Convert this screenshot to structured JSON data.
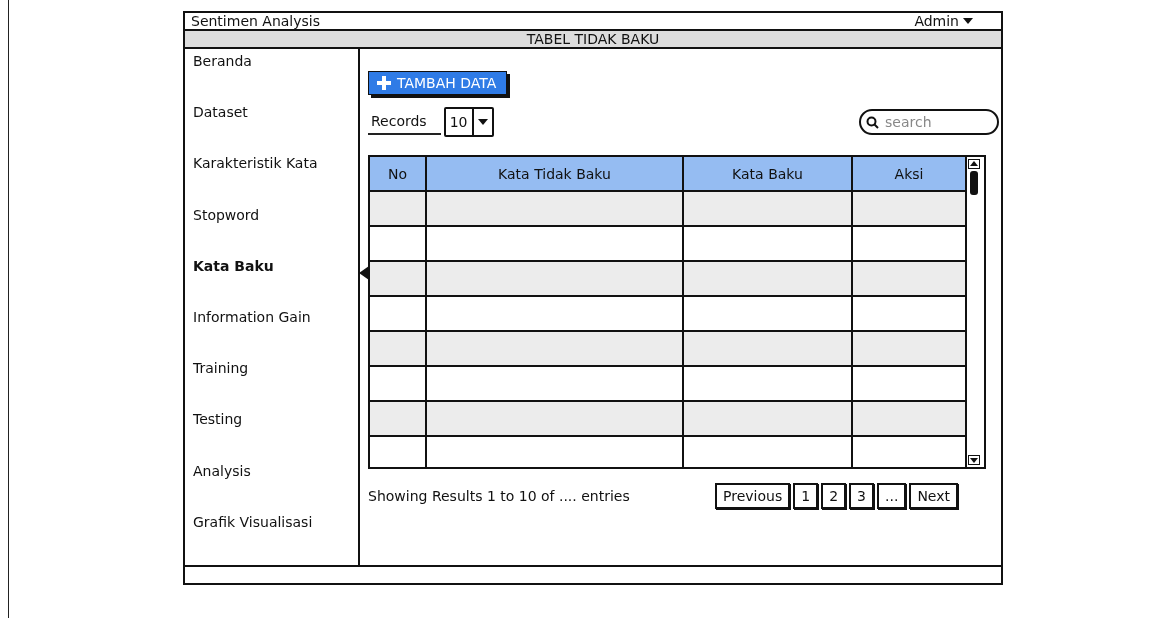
{
  "app_title": "Sentimen Analysis",
  "user_menu": {
    "label": "Admin"
  },
  "page_title": "TABEL TIDAK BAKU",
  "sidebar": {
    "items": [
      {
        "label": "Beranda",
        "selected": false
      },
      {
        "label": "Dataset",
        "selected": false
      },
      {
        "label": "Karakteristik Kata",
        "selected": false
      },
      {
        "label": "Stopword",
        "selected": false
      },
      {
        "label": "Kata Baku",
        "selected": true
      },
      {
        "label": "Information Gain",
        "selected": false
      },
      {
        "label": "Training",
        "selected": false
      },
      {
        "label": "Testing",
        "selected": false
      },
      {
        "label": "Analysis",
        "selected": false
      },
      {
        "label": "Grafik Visualisasi",
        "selected": false
      }
    ]
  },
  "add_button": {
    "label": "TAMBAH DATA"
  },
  "records": {
    "label": "Records",
    "value": "10"
  },
  "search": {
    "placeholder": "search"
  },
  "table": {
    "columns": [
      "No",
      "Kata Tidak Baku",
      "Kata Baku",
      "Aksi"
    ]
  },
  "footer_text": "Showing Results 1 to 10 of .... entries",
  "pagination": [
    "Previous",
    "1",
    "2",
    "3",
    "...",
    "Next"
  ]
}
